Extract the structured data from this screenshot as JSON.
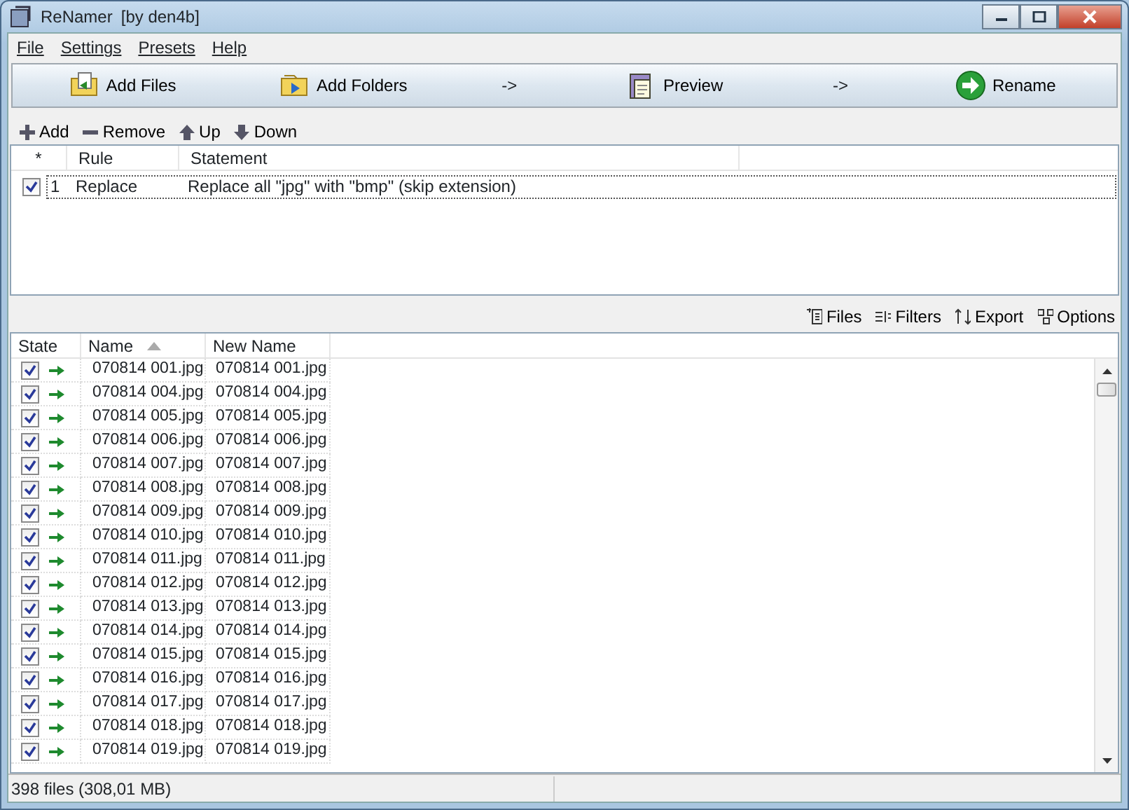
{
  "window": {
    "title": "ReNamer",
    "subtitle": "[by den4b]"
  },
  "menu": [
    "File",
    "Settings",
    "Presets",
    "Help"
  ],
  "toolbar": [
    {
      "kind": "button",
      "label": "Add Files"
    },
    {
      "kind": "button",
      "label": "Add Folders"
    },
    {
      "kind": "arrow",
      "label": "->"
    },
    {
      "kind": "button",
      "label": "Preview"
    },
    {
      "kind": "arrow",
      "label": "->"
    },
    {
      "kind": "button",
      "label": "Rename"
    }
  ],
  "rule_actions": [
    "Add",
    "Remove",
    "Up",
    "Down"
  ],
  "rules": {
    "columns": [
      "*",
      "Rule",
      "Statement"
    ],
    "rows": [
      {
        "checked": true,
        "index": "1",
        "rule": "Replace",
        "statement": "Replace all \"jpg\" with \"bmp\" (skip extension)"
      }
    ]
  },
  "file_actions": [
    "Files",
    "Filters",
    "Export",
    "Options"
  ],
  "files": {
    "columns": [
      {
        "label": "State",
        "sorted": false
      },
      {
        "label": "Name",
        "sorted": true
      },
      {
        "label": "New Name",
        "sorted": false
      }
    ],
    "rows": [
      {
        "checked": true,
        "name": "070814 001.jpg",
        "new_name": "070814 001.jpg"
      },
      {
        "checked": true,
        "name": "070814 004.jpg",
        "new_name": "070814 004.jpg"
      },
      {
        "checked": true,
        "name": "070814 005.jpg",
        "new_name": "070814 005.jpg"
      },
      {
        "checked": true,
        "name": "070814 006.jpg",
        "new_name": "070814 006.jpg"
      },
      {
        "checked": true,
        "name": "070814 007.jpg",
        "new_name": "070814 007.jpg"
      },
      {
        "checked": true,
        "name": "070814 008.jpg",
        "new_name": "070814 008.jpg"
      },
      {
        "checked": true,
        "name": "070814 009.jpg",
        "new_name": "070814 009.jpg"
      },
      {
        "checked": true,
        "name": "070814 010.jpg",
        "new_name": "070814 010.jpg"
      },
      {
        "checked": true,
        "name": "070814 011.jpg",
        "new_name": "070814 011.jpg"
      },
      {
        "checked": true,
        "name": "070814 012.jpg",
        "new_name": "070814 012.jpg"
      },
      {
        "checked": true,
        "name": "070814 013.jpg",
        "new_name": "070814 013.jpg"
      },
      {
        "checked": true,
        "name": "070814 014.jpg",
        "new_name": "070814 014.jpg"
      },
      {
        "checked": true,
        "name": "070814 015.jpg",
        "new_name": "070814 015.jpg"
      },
      {
        "checked": true,
        "name": "070814 016.jpg",
        "new_name": "070814 016.jpg"
      },
      {
        "checked": true,
        "name": "070814 017.jpg",
        "new_name": "070814 017.jpg"
      },
      {
        "checked": true,
        "name": "070814 018.jpg",
        "new_name": "070814 018.jpg"
      },
      {
        "checked": true,
        "name": "070814 019.jpg",
        "new_name": "070814 019.jpg"
      }
    ]
  },
  "status_bar": "398 files (308,01 MB)"
}
